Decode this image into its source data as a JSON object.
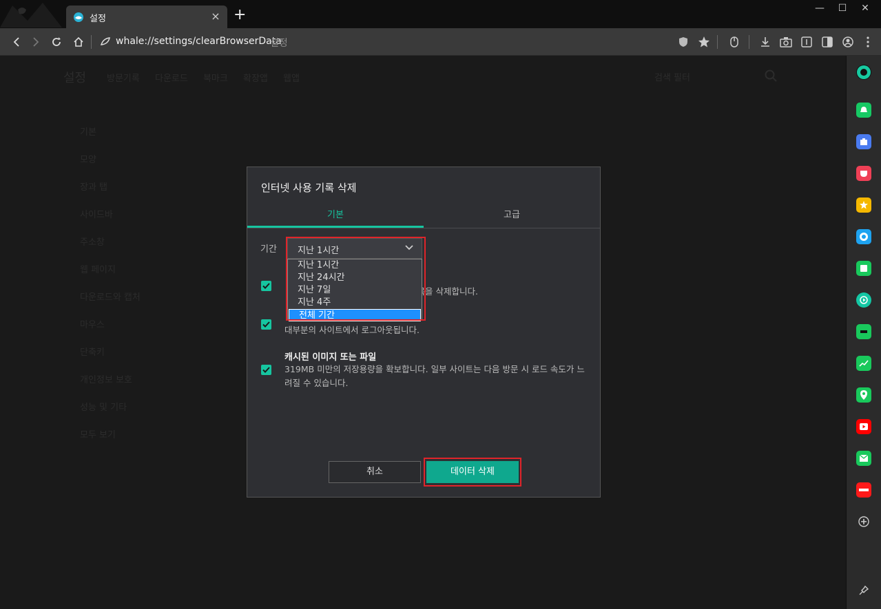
{
  "tab": {
    "title": "설정",
    "close": "×"
  },
  "new_tab": "+",
  "window_controls": {
    "minimize": "—",
    "maximize": "☐",
    "close": "✕"
  },
  "address": {
    "url": "whale://settings/clearBrowserData",
    "page_name": "설정"
  },
  "settings_bg": {
    "title": "설정",
    "nav": [
      "방문기록",
      "다운로드",
      "북마크",
      "확장앱",
      "웹앱"
    ],
    "search_placeholder": "검색 필터",
    "side": [
      "기본",
      "모양",
      "장과 탭",
      "사이드바",
      "주소창",
      "웹 페이지",
      "다운로드와 캡처",
      "마우스",
      "단축키",
      "개인정보 보호",
      "성능 및 기타",
      "모두 보기"
    ]
  },
  "dialog": {
    "title": "인터넷 사용 기록 삭제",
    "tabs": [
      "기본",
      "고급"
    ],
    "period_label": "기간",
    "period_value": "지난 1시간",
    "period_options": [
      "지난 1시간",
      "지난 24시간",
      "지난 7일",
      "지난 4주",
      "전체 기간"
    ],
    "items": [
      {
        "title": "",
        "desc": "항목을 삭제합니다."
      },
      {
        "title": "",
        "desc": "대부분의 사이트에서 로그아웃됩니다."
      },
      {
        "title": "캐시된 이미지 또는 파일",
        "desc": "319MB 미만의 저장용량을 확보합니다. 일부 사이트는 다음 방문 시 로드 속도가 느려질 수 있습니다."
      }
    ],
    "cancel": "취소",
    "delete": "데이터 삭제"
  },
  "colors": {
    "accent": "#16c5a0",
    "highlight_box": "#e0242a",
    "selected_option": "#1e90ff"
  }
}
